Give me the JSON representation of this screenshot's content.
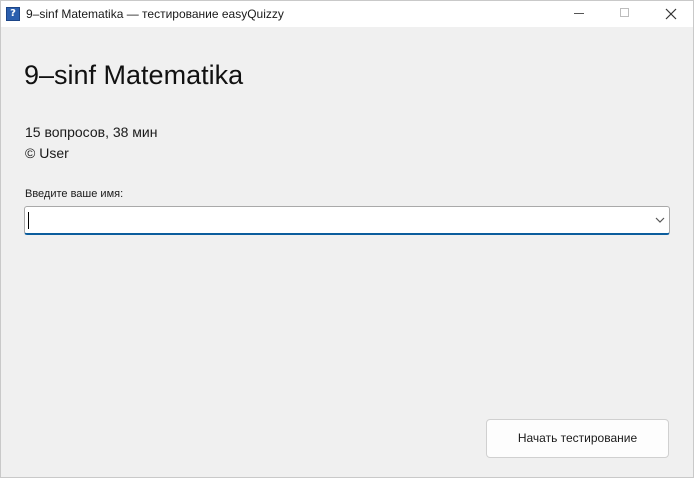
{
  "window": {
    "title": "9–sinf Matematika — тестирование easyQuizzy",
    "app_icon_glyph": "?",
    "controls": [
      "minimize-icon",
      "maximize-icon",
      "close-icon"
    ]
  },
  "quiz": {
    "title": "9–sinf Matematika",
    "summary": "15 вопросов, 38 мин",
    "author": "© User"
  },
  "name_field": {
    "label": "Введите ваше имя:",
    "value": "",
    "placeholder": ""
  },
  "start_button": {
    "label": "Начать тестирование"
  },
  "colors": {
    "background": "#f0f0f0",
    "focus_accent": "#0b5d9d",
    "app_icon": "#2b5fae"
  }
}
